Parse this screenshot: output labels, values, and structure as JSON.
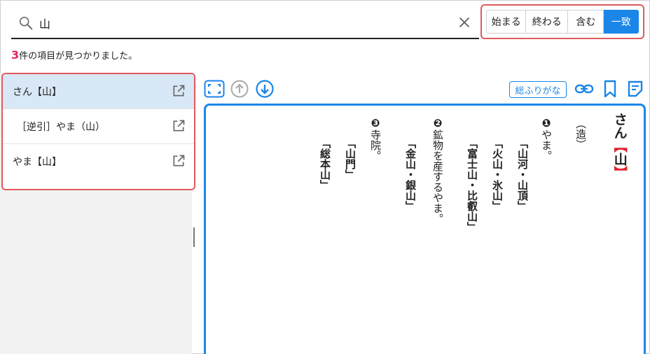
{
  "search": {
    "value": "山",
    "placeholder": ""
  },
  "modes": {
    "starts": "始まる",
    "ends": "終わる",
    "contains": "含む",
    "exact": "一致"
  },
  "results_count": {
    "number": "3",
    "suffix": "件の項目が見つかりました。"
  },
  "results": [
    {
      "label": "さん【山】"
    },
    {
      "label": "［逆引］やま（山）"
    },
    {
      "label": "やま【山】"
    }
  ],
  "toolbar": {
    "furigana_label": "総ふりがな"
  },
  "entry": {
    "reading": "さん",
    "head_open": "【",
    "head_kanji": "山",
    "head_close": "】",
    "kind": "（造）",
    "sense1_mark": "❶",
    "sense1_text": "やま。",
    "ex1": "「山河・山頂」",
    "ex2": "「火山・氷山」",
    "ex3": "「富士山・比叡山」",
    "sense2_mark": "❷",
    "sense2_text": "鉱物を産するやま。",
    "ex4": "「金山・銀山」",
    "sense3_mark": "❸",
    "sense3_text": "寺院。",
    "ex5": "「山門」",
    "ex6": "「総本山」"
  },
  "colors": {
    "accent": "#1a86e8",
    "highlight_border": "#e05a5a",
    "count": "#e0245e",
    "headword": "#e0242e"
  }
}
